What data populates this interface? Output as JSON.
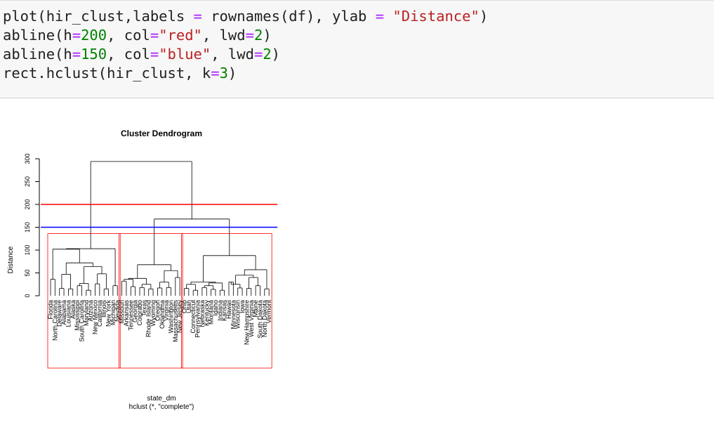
{
  "code_cell": {
    "lines": [
      [
        {
          "t": "plain",
          "v": "plot(hir_clust,labels "
        },
        {
          "t": "op",
          "v": "="
        },
        {
          "t": "plain",
          "v": " rownames(df), ylab "
        },
        {
          "t": "op",
          "v": "="
        },
        {
          "t": "plain",
          "v": " "
        },
        {
          "t": "str",
          "v": "\"Distance\""
        },
        {
          "t": "plain",
          "v": ")"
        }
      ],
      [
        {
          "t": "plain",
          "v": "abline(h"
        },
        {
          "t": "op",
          "v": "="
        },
        {
          "t": "num",
          "v": "200"
        },
        {
          "t": "plain",
          "v": ", col"
        },
        {
          "t": "op",
          "v": "="
        },
        {
          "t": "str",
          "v": "\"red\""
        },
        {
          "t": "plain",
          "v": ", lwd"
        },
        {
          "t": "op",
          "v": "="
        },
        {
          "t": "num",
          "v": "2"
        },
        {
          "t": "plain",
          "v": ")"
        }
      ],
      [
        {
          "t": "plain",
          "v": "abline(h"
        },
        {
          "t": "op",
          "v": "="
        },
        {
          "t": "num",
          "v": "150"
        },
        {
          "t": "plain",
          "v": ", col"
        },
        {
          "t": "op",
          "v": "="
        },
        {
          "t": "str",
          "v": "\"blue\""
        },
        {
          "t": "plain",
          "v": ", lwd"
        },
        {
          "t": "op",
          "v": "="
        },
        {
          "t": "num",
          "v": "2"
        },
        {
          "t": "plain",
          "v": ")"
        }
      ],
      [
        {
          "t": "plain",
          "v": "rect.hclust(hir_clust, k"
        },
        {
          "t": "op",
          "v": "="
        },
        {
          "t": "num",
          "v": "3"
        },
        {
          "t": "plain",
          "v": ")"
        }
      ]
    ],
    "colors": {
      "string": "#ba2121",
      "number": "#008000",
      "operator": "#aa22ff"
    }
  },
  "plot": {
    "title": "Cluster Dendrogram",
    "ylabel": "Distance",
    "xlabel": "state_dm",
    "sub": "hclust (*, \"complete\")",
    "yticks": [
      0,
      50,
      100,
      150,
      200,
      250,
      300
    ],
    "ylim": [
      0,
      300
    ],
    "labels": [
      "Florida",
      "North Carolina",
      "Delaware",
      "Alabama",
      "Louisiana",
      "Alaska",
      "Mississippi",
      "South Carolina",
      "Maryland",
      "Arizona",
      "New Mexico",
      "California",
      "Illinois",
      "New York",
      "Michigan",
      "Nevada",
      "Missouri",
      "Arkansas",
      "Tennessee",
      "Georgia",
      "Colorado",
      "Texas",
      "Rhode Island",
      "Wyoming",
      "Oregon",
      "Oklahoma",
      "Virginia",
      "Washington",
      "Massachusetts",
      "New Jersey",
      "Ohio",
      "Utah",
      "Connecticut",
      "Pennsylvania",
      "Nebraska",
      "Kentucky",
      "Montana",
      "Idaho",
      "Indiana",
      "Kansas",
      "Hawaii",
      "Minnesota",
      "Wisconsin",
      "Iowa",
      "New Hampshire",
      "West Virginia",
      "Maine",
      "South Dakota",
      "North Dakota",
      "Vermont"
    ],
    "abline_red": {
      "h": 200,
      "color": "#ff0000"
    },
    "abline_blue": {
      "h": 150,
      "color": "#0000ff"
    },
    "rect_color": "#ff0000",
    "clusters": [
      [
        0,
        15
      ],
      [
        16,
        29
      ],
      [
        30,
        49
      ]
    ],
    "merges": [
      {
        "l": 0,
        "r": 1,
        "h": 36
      },
      {
        "l": 2,
        "r": 3,
        "h": 16
      },
      {
        "l": 4,
        "r": 5,
        "h": 15
      },
      {
        "l": "m1",
        "r": "m2",
        "h": 47
      },
      {
        "l": 6,
        "r": 7,
        "h": 22
      },
      {
        "l": 8,
        "r": 9,
        "h": 12
      },
      {
        "l": "m4",
        "r": "m5",
        "h": 27
      },
      {
        "l": 10,
        "r": 11,
        "h": 26
      },
      {
        "l": 12,
        "r": 13,
        "h": 15
      },
      {
        "l": "m7",
        "r": "m8",
        "h": 48
      },
      {
        "l": "m6",
        "r": "m9",
        "h": 64
      },
      {
        "l": "m3",
        "r": "m10",
        "h": 72
      },
      {
        "l": 14,
        "r": 15,
        "h": 22
      },
      {
        "l": "m0",
        "r": "m11",
        "h": 102
      },
      {
        "l": "m13",
        "r": "m12",
        "h": 103
      },
      {
        "l": 16,
        "r": 17,
        "h": 32
      },
      {
        "l": 18,
        "r": 19,
        "h": 20
      },
      {
        "l": "m15",
        "r": "m16",
        "h": 36
      },
      {
        "l": 20,
        "r": 21,
        "h": 18
      },
      {
        "l": 22,
        "r": 23,
        "h": 15
      },
      {
        "l": "m18",
        "r": "m19",
        "h": 25
      },
      {
        "l": "m17",
        "r": "m20",
        "h": 38
      },
      {
        "l": 24,
        "r": 25,
        "h": 17
      },
      {
        "l": 26,
        "r": 27,
        "h": 18
      },
      {
        "l": "m22",
        "r": "m23",
        "h": 30
      },
      {
        "l": 28,
        "r": 29,
        "h": 40
      },
      {
        "l": "m24",
        "r": "m25",
        "h": 55
      },
      {
        "l": "m21",
        "r": "m26",
        "h": 68
      },
      {
        "l": 30,
        "r": 31,
        "h": 16
      },
      {
        "l": 32,
        "r": 33,
        "h": 12
      },
      {
        "l": "m28",
        "r": "m29",
        "h": 25
      },
      {
        "l": 34,
        "r": 35,
        "h": 18
      },
      {
        "l": 36,
        "r": 37,
        "h": 14
      },
      {
        "l": "m31",
        "r": "m32",
        "h": 22
      },
      {
        "l": 38,
        "r": 39,
        "h": 12
      },
      {
        "l": "m33",
        "r": "m34",
        "h": 28
      },
      {
        "l": "m30",
        "r": "m35",
        "h": 30
      },
      {
        "l": 40,
        "r": 41,
        "h": 30
      },
      {
        "l": 42,
        "r": 43,
        "h": 17
      },
      {
        "l": "m37",
        "r": "m38",
        "h": 25
      },
      {
        "l": 44,
        "r": 45,
        "h": 16
      },
      {
        "l": 46,
        "r": 47,
        "h": 22
      },
      {
        "l": "m40",
        "r": "m41",
        "h": 40
      },
      {
        "l": 48,
        "r": 49,
        "h": 15
      },
      {
        "l": "m39",
        "r": "m42",
        "h": 45
      },
      {
        "l": "m44",
        "r": "m43",
        "h": 57
      },
      {
        "l": "m36",
        "r": "m45",
        "h": 88
      },
      {
        "l": "m27",
        "r": "m46",
        "h": 168
      },
      {
        "l": "m14",
        "r": "m47",
        "h": 294
      }
    ]
  }
}
